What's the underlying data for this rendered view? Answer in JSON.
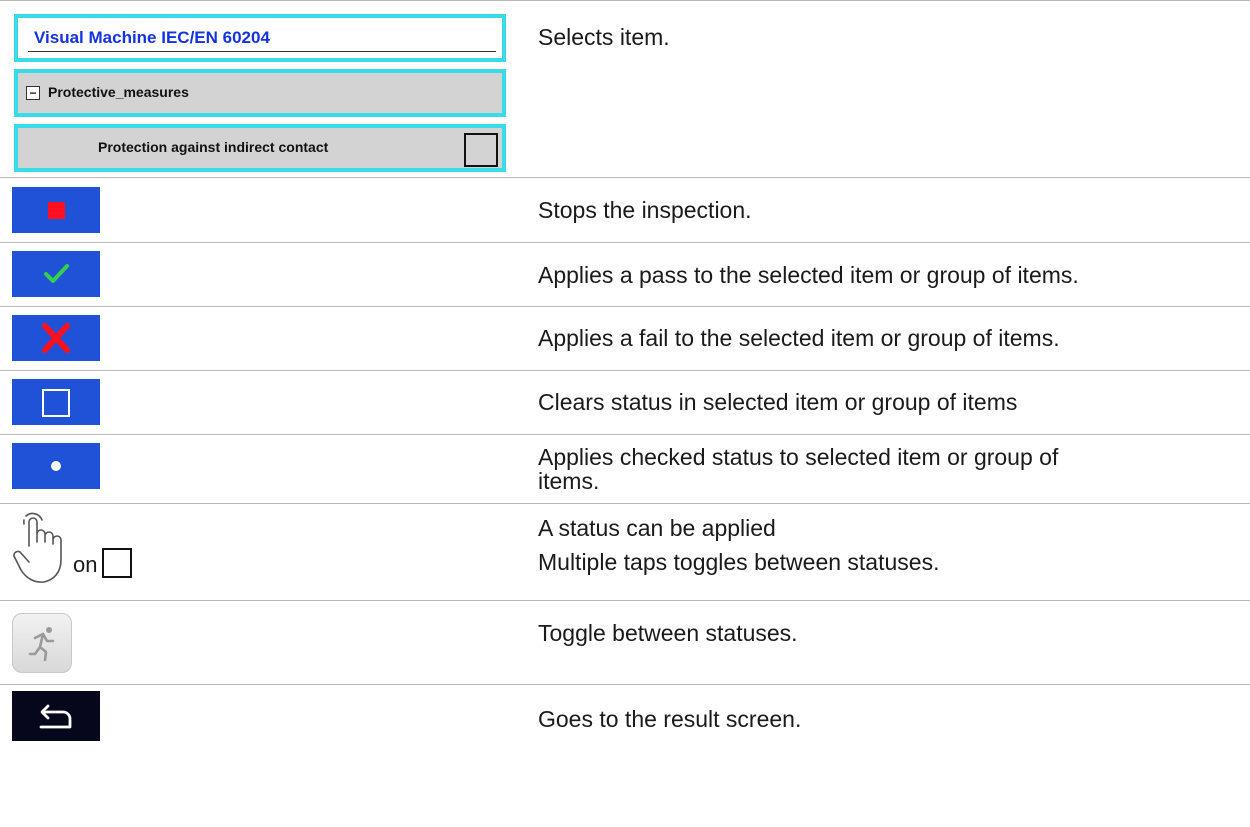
{
  "mock_ui": {
    "title": "Visual Machine IEC/EN 60204",
    "group": "Protective_measures",
    "item": "Protection against indirect contact"
  },
  "rows": {
    "select": {
      "description": "Selects item."
    },
    "stop": {
      "icon": "stop-icon",
      "description": "Stops the inspection."
    },
    "pass": {
      "icon": "check-icon",
      "description": "Applies a pass to the selected item or group of items."
    },
    "fail": {
      "icon": "cross-icon",
      "description": "Applies a fail to the selected item or group of items."
    },
    "clear": {
      "icon": "empty-square-icon",
      "description": "Clears status in selected item or group of items"
    },
    "checked": {
      "icon": "dot-icon",
      "description_line1": "Applies checked status to selected item or group of",
      "description_line2": "items."
    },
    "tap": {
      "icon": "tap-hand-icon",
      "on_label": "on",
      "description_line1": "A status can be applied",
      "description_line2": "Multiple taps toggles between statuses."
    },
    "toggle": {
      "icon": "run-icon",
      "description": "Toggle between statuses."
    },
    "back": {
      "icon": "back-arrow-icon",
      "description": "Goes to the result screen."
    }
  },
  "colors": {
    "button_blue": "#1f52d6",
    "selection_cyan": "#38dce8",
    "title_blue": "#1433e0",
    "pass_green": "#35d04a",
    "fail_red": "#ff1020",
    "back_dark": "#06061c"
  }
}
